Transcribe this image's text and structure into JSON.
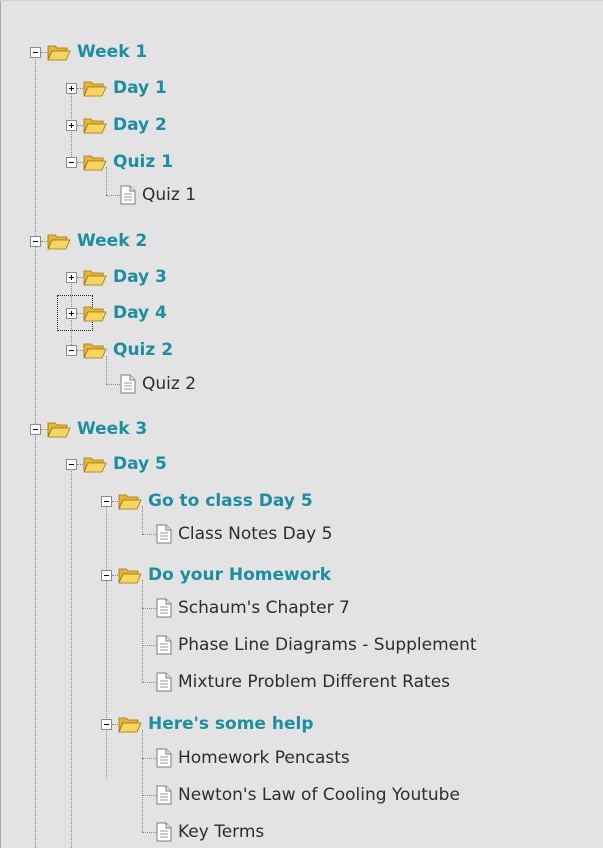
{
  "tree": {
    "week1": {
      "label": "Week 1",
      "day1": "Day 1",
      "day2": "Day 2",
      "quiz1_folder": "Quiz 1",
      "quiz1_item": "Quiz 1"
    },
    "week2": {
      "label": "Week 2",
      "day3": "Day 3",
      "day4": "Day 4",
      "quiz2_folder": "Quiz 2",
      "quiz2_item": "Quiz 2"
    },
    "week3": {
      "label": "Week 3",
      "day5": {
        "label": "Day 5",
        "class": {
          "label": "Go to class Day 5",
          "items": [
            "Class Notes Day 5"
          ]
        },
        "homework": {
          "label": "Do your Homework",
          "items": [
            "Schaum's Chapter 7",
            "Phase Line Diagrams - Supplement",
            "Mixture Problem Different Rates"
          ]
        },
        "help": {
          "label": "Here's some help",
          "items": [
            "Homework Pencasts",
            "Newton's Law of Cooling Youtube",
            "Key Terms"
          ]
        }
      }
    }
  },
  "colors": {
    "folder_text": "#1c8ea2",
    "item_text": "#2d2d2d",
    "background": "#e3e3e3",
    "folder_fill": "#f2c94a"
  },
  "icons": {
    "folder": "open-folder-icon",
    "page": "document-icon",
    "expanded": "collapse-icon",
    "collapsed": "expand-icon"
  }
}
